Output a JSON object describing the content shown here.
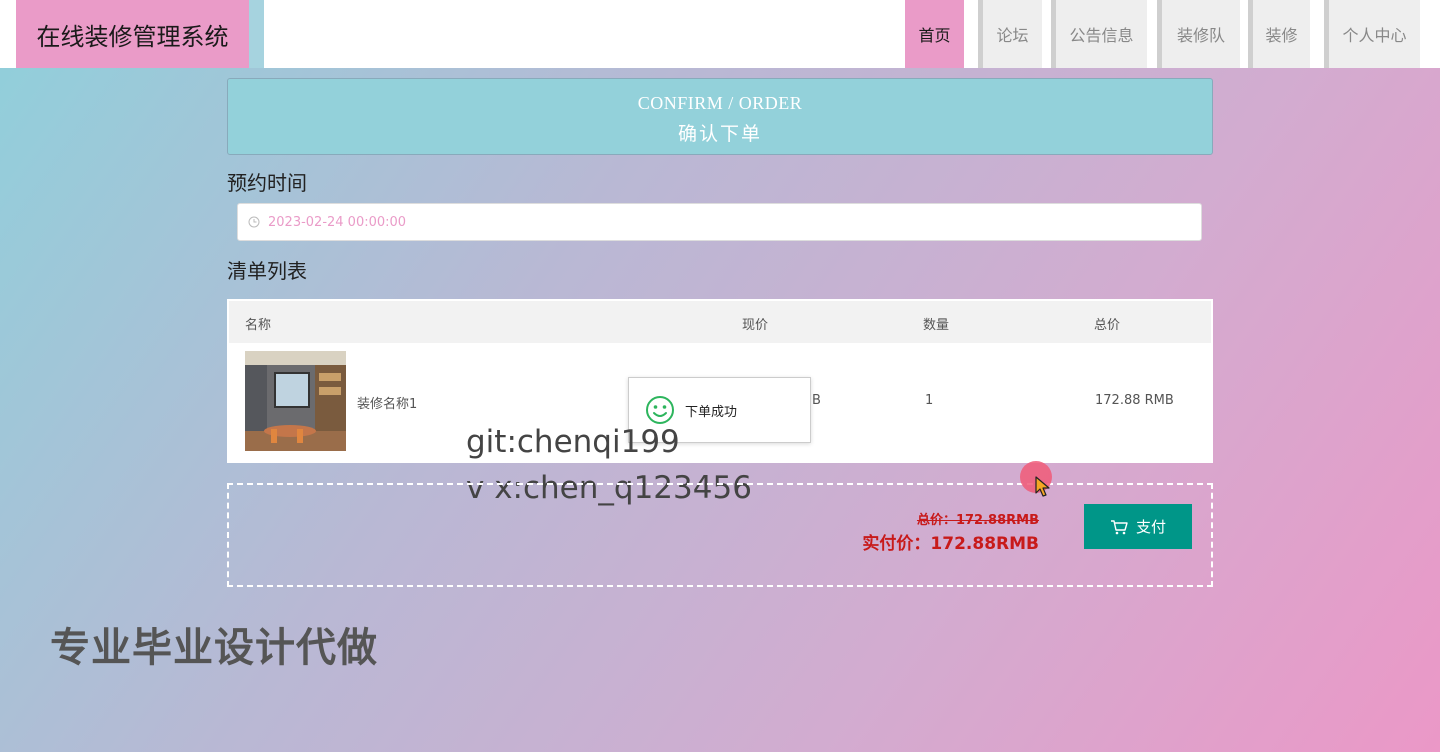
{
  "header": {
    "logo_text": "在线装修管理系统",
    "nav": [
      {
        "label": "首页",
        "active": true
      },
      {
        "label": "论坛"
      },
      {
        "label": "公告信息"
      },
      {
        "label": "装修队"
      },
      {
        "label": "装修"
      },
      {
        "label": "个人中心"
      }
    ]
  },
  "banner": {
    "title_en": "CONFIRM / ORDER",
    "title_cn": "确认下单"
  },
  "appointment": {
    "label": "预约时间",
    "value": "2023-02-24 00:00:00"
  },
  "list": {
    "label": "清单列表",
    "columns": [
      "名称",
      "现价",
      "数量",
      "总价"
    ],
    "rows": [
      {
        "name": "装修名称1",
        "price_visible": "B",
        "quantity": "1",
        "total": "172.88 RMB"
      }
    ]
  },
  "toast": {
    "message": "下单成功"
  },
  "summary": {
    "original_total": "总价：172.88RMB",
    "final_total": "实付价：172.88RMB",
    "pay_label": "支付"
  },
  "watermarks": {
    "line1": "git:chenqi199",
    "line2": "v x:chen_q123456",
    "big": "专业毕业设计代做"
  },
  "colors": {
    "accent_pink": "#ea9bc8",
    "banner_teal": "#93d1da",
    "pay_green": "#009688",
    "price_red": "#c81a1a"
  }
}
